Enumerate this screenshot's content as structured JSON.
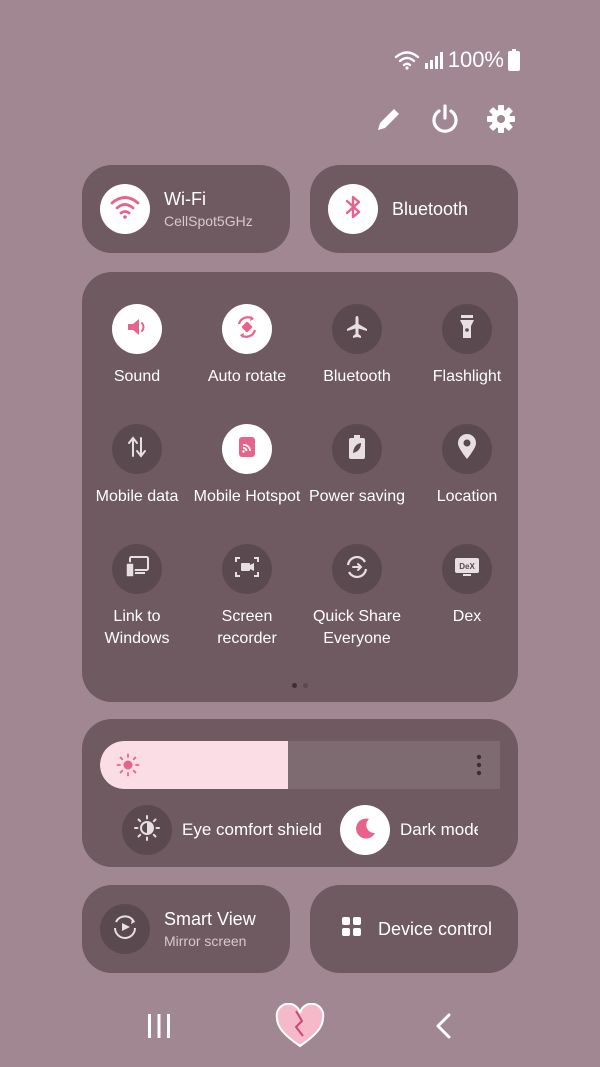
{
  "status_bar": {
    "battery_percent": "100%",
    "icons": [
      "wifi-icon",
      "signal-icon",
      "battery-icon"
    ]
  },
  "top_actions": [
    {
      "name": "edit-button",
      "icon": "pencil-icon"
    },
    {
      "name": "power-button",
      "icon": "power-icon"
    },
    {
      "name": "settings-button",
      "icon": "gear-icon"
    }
  ],
  "wifi_tile": {
    "title": "Wi-Fi",
    "subtitle": "CellSpot5GHz",
    "active": true
  },
  "bluetooth_tile": {
    "title": "Bluetooth",
    "active": true
  },
  "quick_toggles": [
    {
      "label": "Sound",
      "icon": "volume-icon",
      "active": true
    },
    {
      "label": "Auto rotate",
      "icon": "rotate-icon",
      "active": true
    },
    {
      "label": "Bluetooth",
      "icon": "airplane-icon",
      "active": false
    },
    {
      "label": "Flashlight",
      "icon": "flashlight-icon",
      "active": false
    },
    {
      "label": "Mobile data",
      "icon": "mobile-data-icon",
      "active": false
    },
    {
      "label": "Mobile Hotspot",
      "icon": "hotspot-icon",
      "active": true
    },
    {
      "label": "Power saving",
      "icon": "power-saving-icon",
      "active": false
    },
    {
      "label": "Location",
      "icon": "location-pin-icon",
      "active": false
    },
    {
      "label": "Link to Windows",
      "icon": "link-to-windows-icon",
      "active": false
    },
    {
      "label": "Screen recorder",
      "icon": "screen-recorder-icon",
      "active": false
    },
    {
      "label": "Quick Share Everyone",
      "icon": "quick-share-icon",
      "active": false
    },
    {
      "label": "Dex",
      "icon": "dex-icon",
      "active": false
    }
  ],
  "pager": {
    "pages": 2,
    "current": 1
  },
  "brightness": {
    "level_fraction": 0.47
  },
  "eye_comfort": {
    "label": "Eye comfort shield",
    "active": false
  },
  "dark_mode": {
    "label": "Dark mode",
    "active": true
  },
  "smart_view_tile": {
    "title": "Smart View",
    "subtitle": "Mirror screen"
  },
  "device_control_tile": {
    "title": "Device control"
  },
  "nav_bar": {
    "buttons": [
      "recents-button",
      "home-button",
      "back-button"
    ]
  },
  "colors": {
    "background": "#a08791",
    "panel": "#6e5a60",
    "accent": "#e8638b",
    "slider_fill": "#fadde5"
  }
}
